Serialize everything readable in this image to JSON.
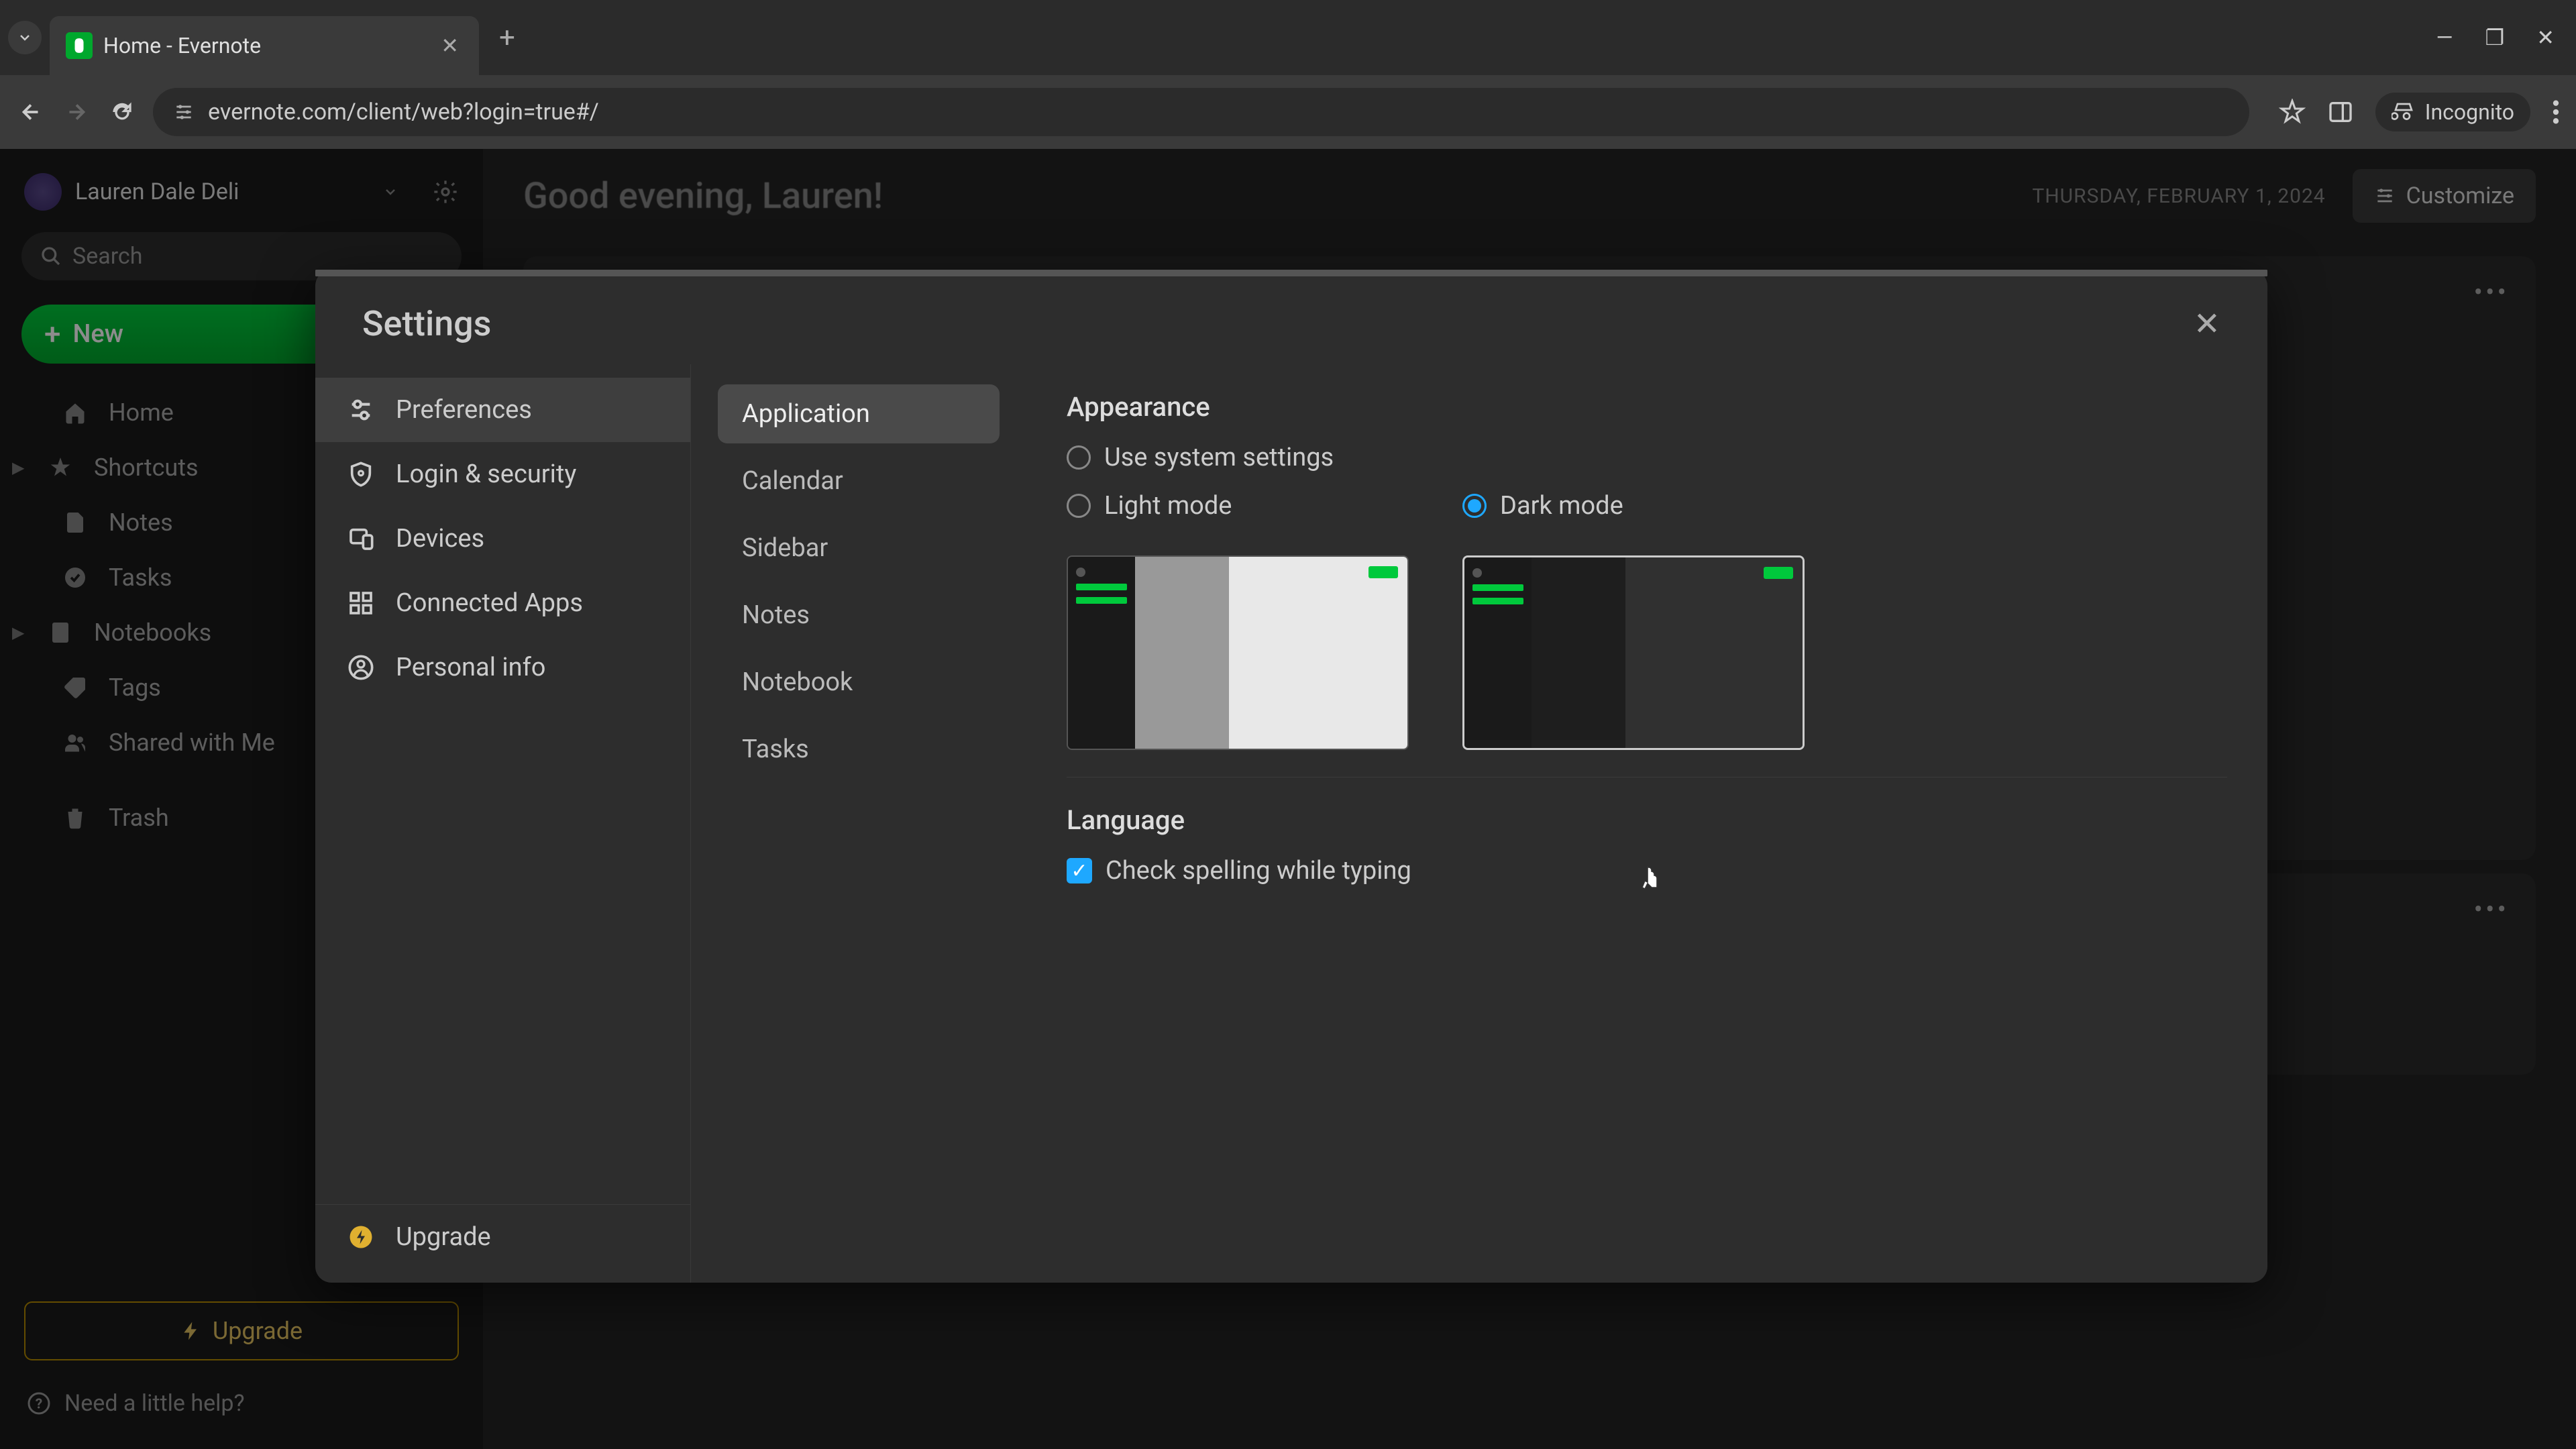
{
  "browser": {
    "tab_title": "Home - Evernote",
    "url": "evernote.com/client/web?login=true#/",
    "incognito_label": "Incognito"
  },
  "sidebar": {
    "user_name": "Lauren Dale Deli",
    "search_placeholder": "Search",
    "new_label": "New",
    "items": [
      {
        "label": "Home",
        "icon": "home"
      },
      {
        "label": "Shortcuts",
        "icon": "star",
        "caret": true
      },
      {
        "label": "Notes",
        "icon": "note"
      },
      {
        "label": "Tasks",
        "icon": "check-circle"
      },
      {
        "label": "Notebooks",
        "icon": "book",
        "caret": true
      },
      {
        "label": "Tags",
        "icon": "tag"
      },
      {
        "label": "Shared with Me",
        "icon": "users"
      },
      {
        "label": "Trash",
        "icon": "trash"
      }
    ],
    "upgrade_label": "Upgrade",
    "help_label": "Need a little help?"
  },
  "main": {
    "greeting": "Good evening, Lauren!",
    "date": "THURSDAY, FEBRUARY 1, 2024",
    "customize_label": "Customize"
  },
  "settings": {
    "title": "Settings",
    "categories": [
      {
        "label": "Preferences",
        "active": true
      },
      {
        "label": "Login & security"
      },
      {
        "label": "Devices"
      },
      {
        "label": "Connected Apps"
      },
      {
        "label": "Personal info"
      }
    ],
    "upgrade_label": "Upgrade",
    "subsections": [
      {
        "label": "Application",
        "active": true
      },
      {
        "label": "Calendar"
      },
      {
        "label": "Sidebar"
      },
      {
        "label": "Notes"
      },
      {
        "label": "Notebook"
      },
      {
        "label": "Tasks"
      }
    ],
    "appearance": {
      "title": "Appearance",
      "option_system": "Use system settings",
      "option_light": "Light mode",
      "option_dark": "Dark mode",
      "selected": "dark"
    },
    "language": {
      "title": "Language",
      "spellcheck_label": "Check spelling while typing",
      "spellcheck_checked": true
    }
  }
}
